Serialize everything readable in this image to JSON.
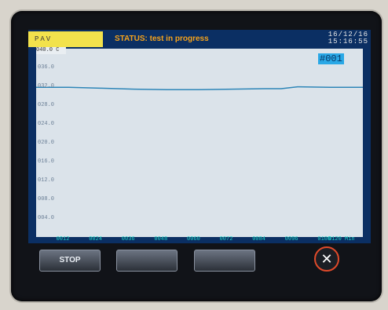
{
  "header": {
    "device_label": "PAV",
    "status": "STATUS: test in progress",
    "date": "16/12/16",
    "time": "15:16:55"
  },
  "plot": {
    "channel_label": "#001",
    "y_top_label": "040.0 C",
    "trend_color": "#2e86b8"
  },
  "chart_data": {
    "type": "line",
    "title": "",
    "x_tick_labels": [
      "0012",
      "0024",
      "0036",
      "0048",
      "0060",
      "0072",
      "0084",
      "0096",
      "0108",
      "0120 Min"
    ],
    "y_tick_labels": [
      "036.0",
      "032.0",
      "028.0",
      "024.0",
      "020.0",
      "016.0",
      "012.0",
      "008.0",
      "004.0"
    ],
    "xlim": [
      0,
      120
    ],
    "ylim": [
      0,
      40
    ],
    "series": [
      {
        "x": [
          0,
          12,
          24,
          36,
          48,
          60,
          72,
          84,
          90,
          96,
          108,
          120
        ],
        "values": [
          31.8,
          31.8,
          31.6,
          31.4,
          31.3,
          31.3,
          31.4,
          31.5,
          31.5,
          31.9,
          31.8,
          31.8
        ]
      }
    ]
  },
  "buttons": {
    "stop": "STOP",
    "blank1": "",
    "blank2": "",
    "close": "✕"
  }
}
